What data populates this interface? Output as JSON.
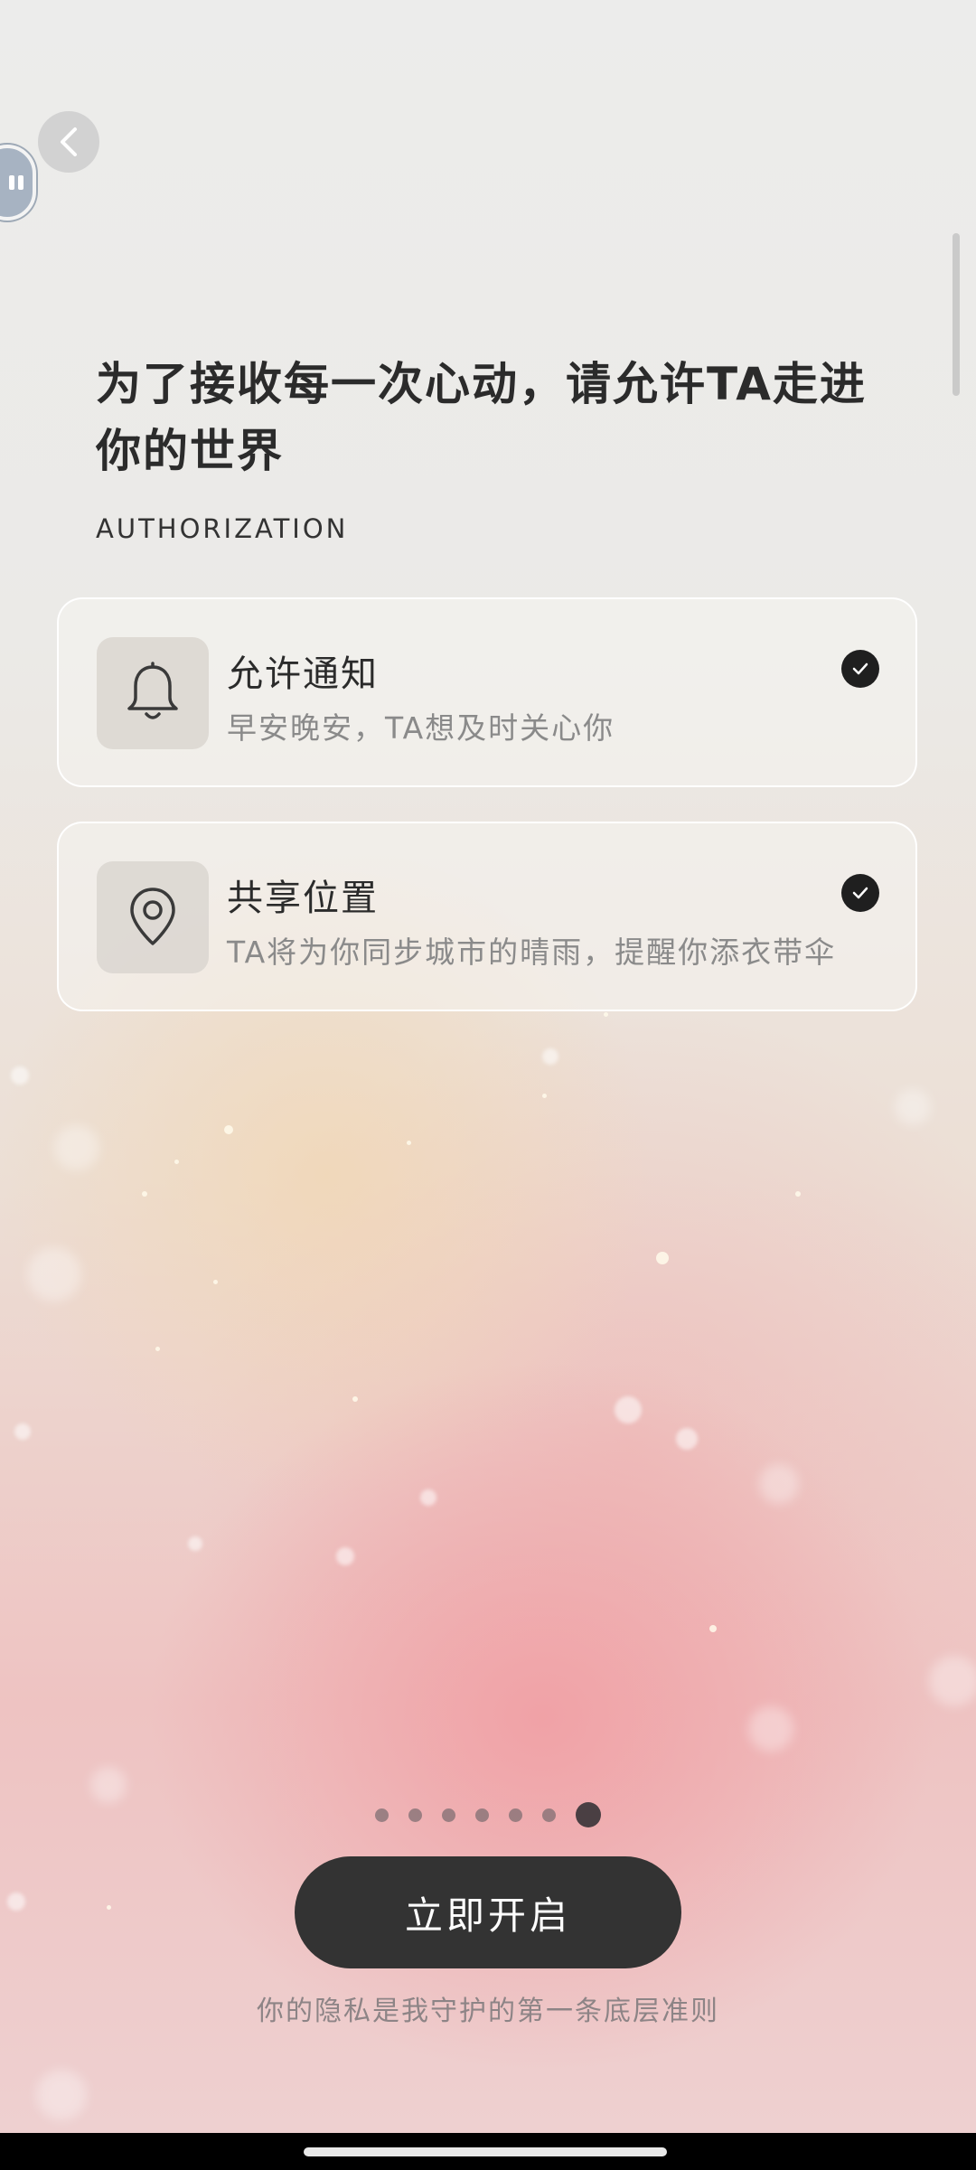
{
  "header": {
    "back_icon": "chevron-left-icon",
    "floating_icon": "pause-icon"
  },
  "page": {
    "title": "为了接收每一次心动，请允许TA走进你的世界",
    "subtitle": "AUTHORIZATION"
  },
  "permissions": [
    {
      "icon": "bell-icon",
      "title": "允许通知",
      "description": "早安晚安，TA想及时关心你",
      "checked": true
    },
    {
      "icon": "location-pin-icon",
      "title": "共享位置",
      "description": "TA将为你同步城市的晴雨，提醒你添衣带伞",
      "checked": true
    }
  ],
  "pager": {
    "total": 7,
    "current": 7
  },
  "cta": {
    "label": "立即开启"
  },
  "footer": {
    "privacy_text": "你的隐私是我守护的第一条底层准则"
  }
}
